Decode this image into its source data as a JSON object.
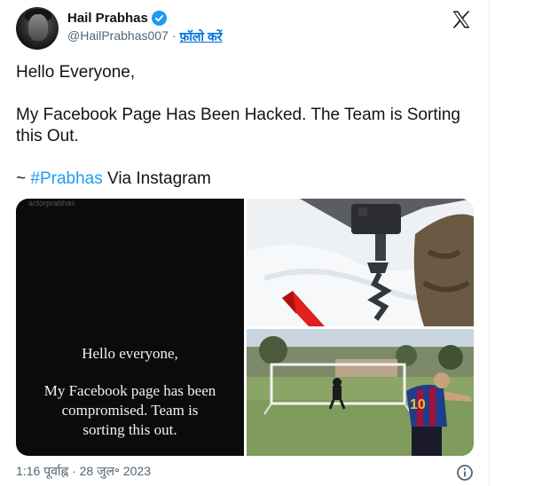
{
  "author": {
    "display_name": "Hail Prabhas",
    "handle": "@HailPrabhas007",
    "separator": "·",
    "follow_label": "फ़ॉलो करें",
    "verified_icon": "verified-badge-icon"
  },
  "brand": {
    "logo": "x-logo-icon"
  },
  "tweet": {
    "line1": "Hello Everyone,",
    "line2": "My Facebook Page Has Been Hacked. The Team is Sorting this Out.",
    "line3_prefix": "~ ",
    "hashtag": "#Prabhas",
    "line3_suffix": " Via Instagram"
  },
  "media": {
    "story": {
      "handle": "actorprabhas",
      "line1": "Hello everyone,",
      "line2": "My Facebook page has been",
      "line3": "compromised. Team is",
      "line4": "sorting this out."
    },
    "jersey_number": "10"
  },
  "footer": {
    "timestamp": "1:16 पूर्वाह्न · 28 जुल॰ 2023",
    "info_icon": "info-icon"
  },
  "colors": {
    "accent": "#1d9bf0",
    "link": "#006fd6",
    "muted": "#536471",
    "text": "#0f1419"
  }
}
